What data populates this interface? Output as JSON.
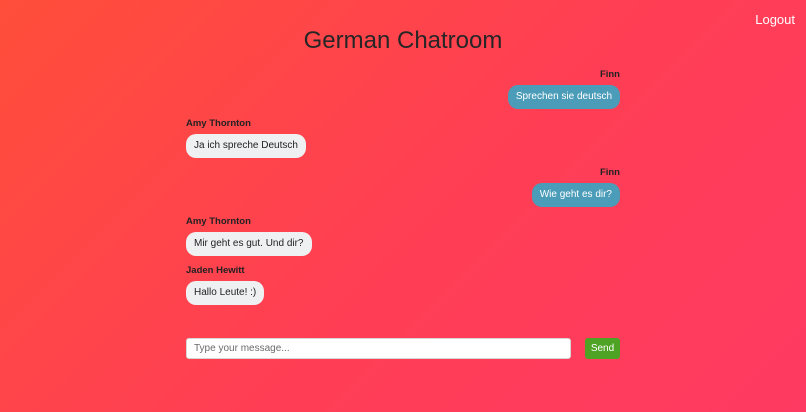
{
  "header": {
    "logout_label": "Logout",
    "title": "German Chatroom"
  },
  "messages": [
    {
      "author": "Finn",
      "text": "Sprechen sie deutsch",
      "self": true
    },
    {
      "author": "Amy Thornton",
      "text": "Ja ich spreche Deutsch",
      "self": false
    },
    {
      "author": "Finn",
      "text": "Wie geht es dir?",
      "self": true
    },
    {
      "author": "Amy Thornton",
      "text": "Mir geht es gut. Und dir?",
      "self": false
    },
    {
      "author": "Jaden Hewitt",
      "text": "Hallo Leute! :)",
      "self": false
    }
  ],
  "composer": {
    "placeholder": "Type your message...",
    "value": "",
    "send_label": "Send"
  },
  "colors": {
    "self_bubble": "#4b9cb8",
    "other_bubble": "#eff0f2",
    "send_button": "#4fa324"
  }
}
